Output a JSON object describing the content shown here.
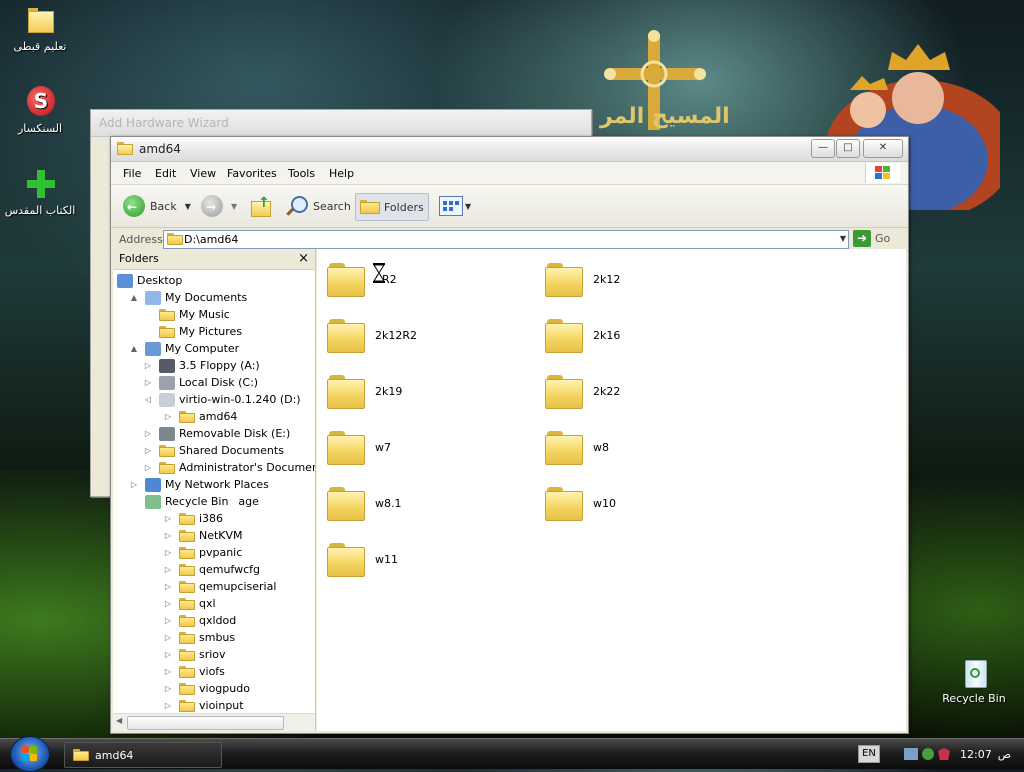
{
  "desktop": {
    "icons": [
      {
        "label": "تعليم قبطى"
      },
      {
        "label": "السنكسار"
      },
      {
        "label": "الكتاب المقدس"
      },
      {
        "label": "Recycle Bin"
      }
    ],
    "wallpaper_text": "المسيح المر"
  },
  "wizard": {
    "title": "Add Hardware Wizard"
  },
  "explorer": {
    "title": "amd64",
    "menu": [
      "File",
      "Edit",
      "View",
      "Favorites",
      "Tools",
      "Help"
    ],
    "toolbar": {
      "back_label": "Back",
      "search_label": "Search",
      "folders_label": "Folders"
    },
    "address": {
      "label": "Address",
      "value": "D:\\amd64",
      "go_label": "Go"
    },
    "folders_pane": {
      "title": "Folders",
      "close_glyph": "×",
      "tree": [
        {
          "label": "Desktop",
          "level": 0,
          "expander": "",
          "icon": "desktop-icon"
        },
        {
          "label": "My Documents",
          "level": 1,
          "expander": "▲",
          "icon": "documents-icon"
        },
        {
          "label": "My Music",
          "level": 2,
          "expander": "",
          "icon": "music-folder-icon"
        },
        {
          "label": "My Pictures",
          "level": 2,
          "expander": "",
          "icon": "pictures-folder-icon"
        },
        {
          "label": "My Computer",
          "level": 1,
          "expander": "▲",
          "icon": "computer-icon"
        },
        {
          "label": "3.5 Floppy (A:)",
          "level": 2,
          "expander": "▷",
          "icon": "floppy-icon"
        },
        {
          "label": "Local Disk (C:)",
          "level": 2,
          "expander": "▷",
          "icon": "disk-icon"
        },
        {
          "label": "virtio-win-0.1.240 (D:)",
          "level": 2,
          "expander": "◁",
          "icon": "cd-icon"
        },
        {
          "label": "amd64",
          "level": 3,
          "expander": "▷",
          "icon": "folder-icon"
        },
        {
          "label": "Removable Disk (E:)",
          "level": 2,
          "expander": "▷",
          "icon": "removable-disk-icon"
        },
        {
          "label": "Shared Documents",
          "level": 2,
          "expander": "▷",
          "icon": "folder-icon"
        },
        {
          "label": "Administrator's Documents",
          "level": 2,
          "expander": "▷",
          "icon": "folder-icon"
        },
        {
          "label": "My Network Places",
          "level": 1,
          "expander": "▷",
          "icon": "network-icon"
        },
        {
          "label": "Recycle Bin",
          "level": 1,
          "expander": "",
          "icon": "recycle-bin-icon",
          "suffix": "age"
        },
        {
          "label": "i386",
          "level": 3,
          "expander": "▷",
          "icon": "folder-icon"
        },
        {
          "label": "NetKVM",
          "level": 3,
          "expander": "▷",
          "icon": "folder-icon"
        },
        {
          "label": "pvpanic",
          "level": 3,
          "expander": "▷",
          "icon": "folder-icon"
        },
        {
          "label": "qemufwcfg",
          "level": 3,
          "expander": "▷",
          "icon": "folder-icon"
        },
        {
          "label": "qemupciserial",
          "level": 3,
          "expander": "▷",
          "icon": "folder-icon"
        },
        {
          "label": "qxl",
          "level": 3,
          "expander": "▷",
          "icon": "folder-icon"
        },
        {
          "label": "qxldod",
          "level": 3,
          "expander": "▷",
          "icon": "folder-icon"
        },
        {
          "label": "smbus",
          "level": 3,
          "expander": "▷",
          "icon": "folder-icon"
        },
        {
          "label": "sriov",
          "level": 3,
          "expander": "▷",
          "icon": "folder-icon"
        },
        {
          "label": "viofs",
          "level": 3,
          "expander": "▷",
          "icon": "folder-icon"
        },
        {
          "label": "viogpudo",
          "level": 3,
          "expander": "▷",
          "icon": "folder-icon"
        },
        {
          "label": "vioinput",
          "level": 3,
          "expander": "▷",
          "icon": "folder-icon"
        }
      ]
    },
    "files": [
      {
        "name": "8R2"
      },
      {
        "name": "2k12"
      },
      {
        "name": "2k12R2"
      },
      {
        "name": "2k16"
      },
      {
        "name": "2k19"
      },
      {
        "name": "2k22"
      },
      {
        "name": "w7"
      },
      {
        "name": "w8"
      },
      {
        "name": "w8.1"
      },
      {
        "name": "w10"
      },
      {
        "name": "w11"
      }
    ]
  },
  "taskbar": {
    "task_label": "amd64",
    "lang": "EN",
    "clock": "12:07",
    "clock_suffix": "ص"
  }
}
